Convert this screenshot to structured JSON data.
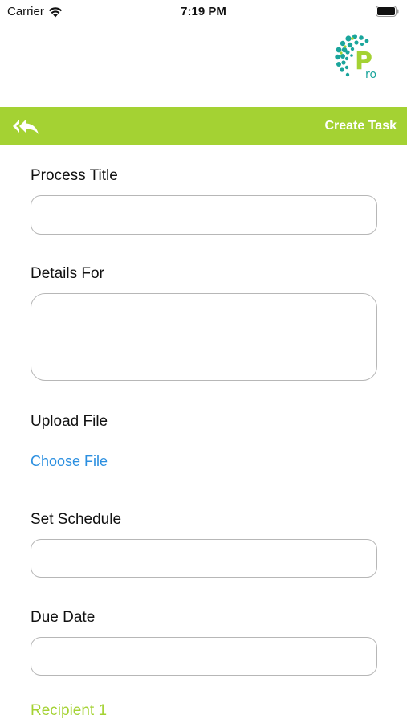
{
  "status_bar": {
    "carrier": "Carrier",
    "time": "7:19 PM"
  },
  "logo": {
    "letters": "Pro",
    "accent": "#a4d233",
    "dots": "#1aa59c"
  },
  "header": {
    "title": "Create Task",
    "back_icon": "reply-all-icon",
    "color": "#a4d233"
  },
  "form": {
    "process_title_label": "Process Title",
    "process_title_value": "",
    "details_label": "Details For",
    "details_value": "",
    "upload_label": "Upload File",
    "choose_file": "Choose File",
    "schedule_label": "Set Schedule",
    "schedule_value": "",
    "due_date_label": "Due Date",
    "due_date_value": "",
    "recipient_label": "Recipient 1"
  },
  "colors": {
    "link": "#2b8fe0",
    "border": "#b7b7b7"
  }
}
